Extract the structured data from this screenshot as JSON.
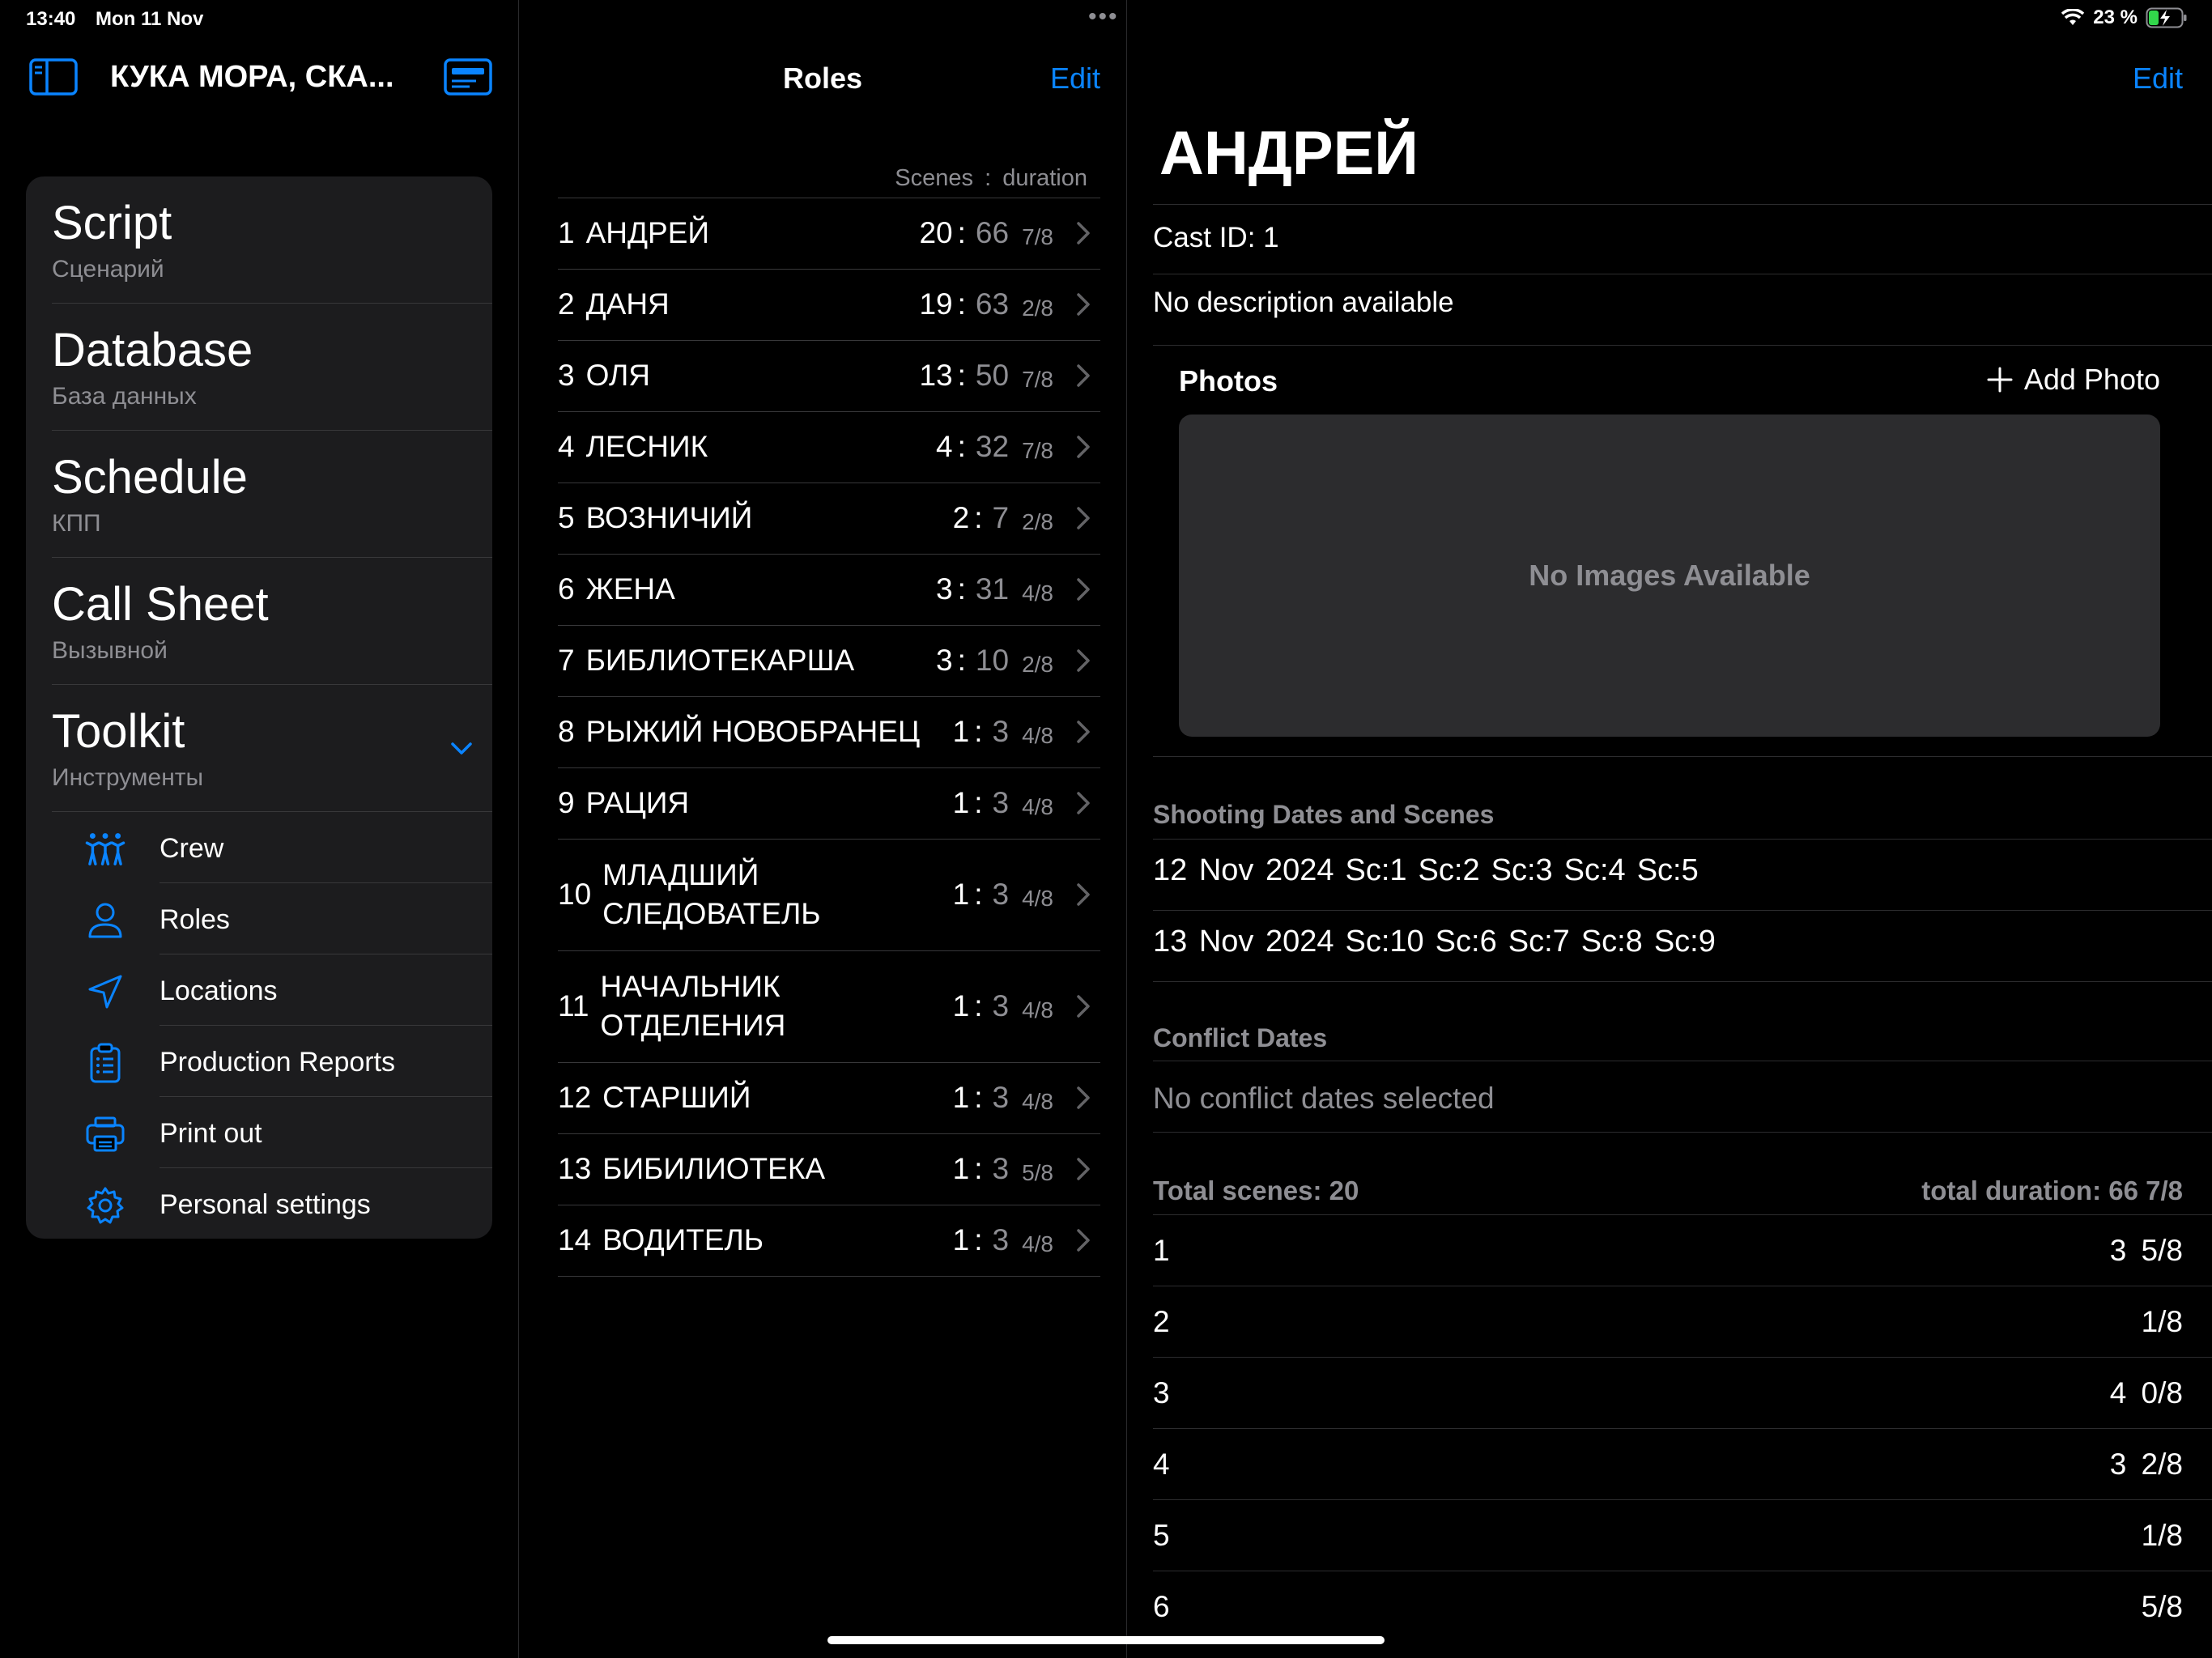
{
  "status_bar": {
    "time": "13:40",
    "date": "Mon 11 Nov",
    "battery": "23 %"
  },
  "sidebar": {
    "project_title": "КУКА МОРА, СКА...",
    "sections": [
      {
        "title": "Script",
        "subtitle": "Сценарий"
      },
      {
        "title": "Database",
        "subtitle": "База данных"
      },
      {
        "title": "Schedule",
        "subtitle": "КПП"
      },
      {
        "title": "Call Sheet",
        "subtitle": "Вызывной"
      },
      {
        "title": "Toolkit",
        "subtitle": "Инструменты"
      }
    ],
    "toolkit_items": [
      {
        "label": "Crew",
        "icon": "people-icon"
      },
      {
        "label": "Roles",
        "icon": "person-icon"
      },
      {
        "label": "Locations",
        "icon": "location-arrow-icon"
      },
      {
        "label": "Production Reports",
        "icon": "clipboard-icon"
      },
      {
        "label": "Print out",
        "icon": "printer-icon"
      },
      {
        "label": "Personal settings",
        "icon": "gear-icon"
      }
    ]
  },
  "roles": {
    "title": "Roles",
    "edit_label": "Edit",
    "column_header": "Scenes : duration",
    "items": [
      {
        "num": "1",
        "name": "АНДРЕЙ",
        "scenes": "20",
        "duration": "66",
        "frac": "7/8"
      },
      {
        "num": "2",
        "name": "ДАНЯ",
        "scenes": "19",
        "duration": "63",
        "frac": "2/8"
      },
      {
        "num": "3",
        "name": "ОЛЯ",
        "scenes": "13",
        "duration": "50",
        "frac": "7/8"
      },
      {
        "num": "4",
        "name": "ЛЕСНИК",
        "scenes": "4",
        "duration": "32",
        "frac": "7/8"
      },
      {
        "num": "5",
        "name": "ВОЗНИЧИЙ",
        "scenes": "2",
        "duration": "7",
        "frac": "2/8"
      },
      {
        "num": "6",
        "name": "ЖЕНА",
        "scenes": "3",
        "duration": "31",
        "frac": "4/8"
      },
      {
        "num": "7",
        "name": "БИБЛИОТЕКАРША",
        "scenes": "3",
        "duration": "10",
        "frac": "2/8"
      },
      {
        "num": "8",
        "name": "РЫЖИЙ НОВОБРАНЕЦ",
        "scenes": "1",
        "duration": "3",
        "frac": "4/8"
      },
      {
        "num": "9",
        "name": "РАЦИЯ",
        "scenes": "1",
        "duration": "3",
        "frac": "4/8"
      },
      {
        "num": "10",
        "name": "МЛАДШИЙ",
        "name2": "СЛЕДОВАТЕЛЬ",
        "scenes": "1",
        "duration": "3",
        "frac": "4/8"
      },
      {
        "num": "11",
        "name": "НАЧАЛЬНИК",
        "name2": "ОТДЕЛЕНИЯ",
        "scenes": "1",
        "duration": "3",
        "frac": "4/8"
      },
      {
        "num": "12",
        "name": "СТАРШИЙ",
        "scenes": "1",
        "duration": "3",
        "frac": "4/8"
      },
      {
        "num": "13",
        "name": "БИБИЛИОТЕКА",
        "scenes": "1",
        "duration": "3",
        "frac": "5/8"
      },
      {
        "num": "14",
        "name": "ВОДИТЕЛЬ",
        "scenes": "1",
        "duration": "3",
        "frac": "4/8"
      }
    ]
  },
  "detail": {
    "edit_label": "Edit",
    "name": "АНДРЕЙ",
    "cast_id": "Cast ID: 1",
    "description": "No description available",
    "photos_label": "Photos",
    "add_photo_label": "Add Photo",
    "no_images": "No Images Available",
    "shooting_header": "Shooting Dates and Scenes",
    "shooting_dates": [
      {
        "date": "12 Nov 2024",
        "scenes": [
          "Sc:1",
          "Sc:2",
          "Sc:3",
          "Sc:4",
          "Sc:5"
        ]
      },
      {
        "date": "13 Nov 2024",
        "scenes": [
          "Sc:10",
          "Sc:6",
          "Sc:7",
          "Sc:8",
          "Sc:9"
        ]
      }
    ],
    "conflict_header": "Conflict Dates",
    "conflict_text": "No conflict dates selected",
    "total_scenes": "Total scenes: 20",
    "total_duration": "total duration: 66 7/8",
    "scenes": [
      {
        "n": "1",
        "d": "3 5/8"
      },
      {
        "n": "2",
        "d": "1/8"
      },
      {
        "n": "3",
        "d": "4 0/8"
      },
      {
        "n": "4",
        "d": "3 2/8"
      },
      {
        "n": "5",
        "d": "1/8"
      },
      {
        "n": "6",
        "d": "5/8"
      }
    ]
  },
  "colors": {
    "accent": "#0a84ff",
    "background": "#000000",
    "card": "#1c1c1e",
    "secondary_text": "#8e8e93"
  }
}
